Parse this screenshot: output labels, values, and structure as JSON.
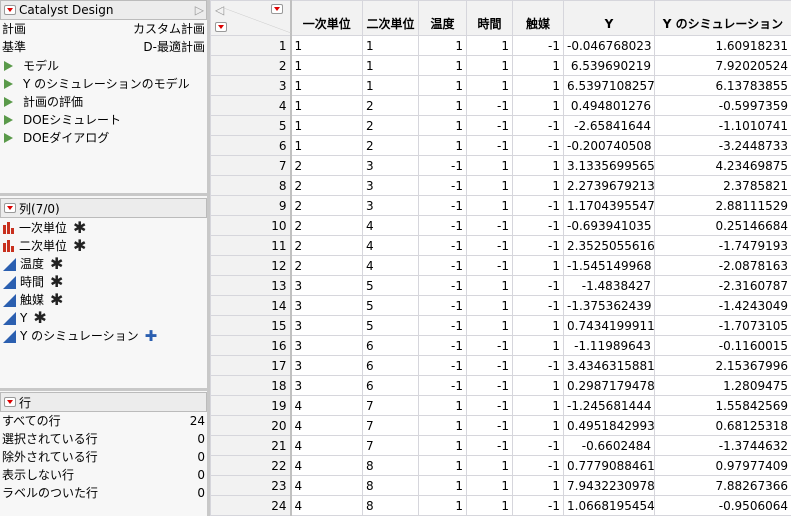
{
  "left": {
    "title": "Catalyst Design",
    "props": [
      {
        "k": "計画",
        "v": "カスタム計画"
      },
      {
        "k": "基準",
        "v": "D-最適計画"
      }
    ],
    "scripts": [
      "モデル",
      "Y のシミュレーションのモデル",
      "計画の評価",
      "DOEシミュレート",
      "DOEダイアログ"
    ],
    "columns_header": "列(7/0)",
    "columns": [
      {
        "name": "一次単位",
        "type": "nominal",
        "badge": "✱"
      },
      {
        "name": "二次単位",
        "type": "nominal",
        "badge": "✱"
      },
      {
        "name": "温度",
        "type": "continuous",
        "badge": "✱"
      },
      {
        "name": "時間",
        "type": "continuous",
        "badge": "✱"
      },
      {
        "name": "触媒",
        "type": "continuous",
        "badge": "✱"
      },
      {
        "name": "Y",
        "type": "continuous",
        "badge": "✱"
      },
      {
        "name": "Y のシミュレーション",
        "type": "continuous",
        "badge": "✚"
      }
    ],
    "rows_header": "行",
    "rows": [
      {
        "k": "すべての行",
        "v": "24"
      },
      {
        "k": "選択されている行",
        "v": "0"
      },
      {
        "k": "除外されている行",
        "v": "0"
      },
      {
        "k": "表示しない行",
        "v": "0"
      },
      {
        "k": "ラベルのついた行",
        "v": "0"
      }
    ]
  },
  "table": {
    "headers": [
      "一次単位",
      "二次単位",
      "温度",
      "時間",
      "触媒",
      "Y",
      "Y のシミュレーション"
    ],
    "rows": [
      [
        "1",
        "1",
        "1",
        "1",
        "1",
        "-1",
        "-0.046768023",
        "1.60918231"
      ],
      [
        "2",
        "1",
        "1",
        "1",
        "1",
        "1",
        "6.539690219",
        "7.92020524"
      ],
      [
        "3",
        "1",
        "1",
        "1",
        "1",
        "1",
        "6.5397108257",
        "6.13783855"
      ],
      [
        "4",
        "1",
        "2",
        "1",
        "-1",
        "1",
        "0.494801276",
        "-0.5997359"
      ],
      [
        "5",
        "1",
        "2",
        "1",
        "-1",
        "-1",
        "-2.65841644",
        "-1.1010741"
      ],
      [
        "6",
        "1",
        "2",
        "1",
        "-1",
        "-1",
        "-0.200740508",
        "-3.2448733"
      ],
      [
        "7",
        "2",
        "3",
        "-1",
        "1",
        "1",
        "3.1335699565",
        "4.23469875"
      ],
      [
        "8",
        "2",
        "3",
        "-1",
        "1",
        "1",
        "2.2739679213",
        "2.3785821"
      ],
      [
        "9",
        "2",
        "3",
        "-1",
        "1",
        "-1",
        "1.1704395547",
        "2.88111529"
      ],
      [
        "10",
        "2",
        "4",
        "-1",
        "-1",
        "-1",
        "-0.693941035",
        "0.25146684"
      ],
      [
        "11",
        "2",
        "4",
        "-1",
        "-1",
        "-1",
        "2.3525055616",
        "-1.7479193"
      ],
      [
        "12",
        "2",
        "4",
        "-1",
        "-1",
        "1",
        "-1.545149968",
        "-2.0878163"
      ],
      [
        "13",
        "3",
        "5",
        "-1",
        "1",
        "-1",
        "-1.4838427",
        "-2.3160787"
      ],
      [
        "14",
        "3",
        "5",
        "-1",
        "1",
        "-1",
        "-1.375362439",
        "-1.4243049"
      ],
      [
        "15",
        "3",
        "5",
        "-1",
        "1",
        "1",
        "0.7434199911",
        "-1.7073105"
      ],
      [
        "16",
        "3",
        "6",
        "-1",
        "-1",
        "1",
        "-1.11989643",
        "-0.1160015"
      ],
      [
        "17",
        "3",
        "6",
        "-1",
        "-1",
        "-1",
        "3.4346315881",
        "2.15367996"
      ],
      [
        "18",
        "3",
        "6",
        "-1",
        "-1",
        "1",
        "0.2987179478",
        "1.2809475"
      ],
      [
        "19",
        "4",
        "7",
        "1",
        "-1",
        "1",
        "-1.245681444",
        "1.55842569"
      ],
      [
        "20",
        "4",
        "7",
        "1",
        "-1",
        "1",
        "0.4951842993",
        "0.68125318"
      ],
      [
        "21",
        "4",
        "7",
        "1",
        "-1",
        "-1",
        "-0.6602484",
        "-1.3744632"
      ],
      [
        "22",
        "4",
        "8",
        "1",
        "1",
        "-1",
        "0.7779088461",
        "0.97977409"
      ],
      [
        "23",
        "4",
        "8",
        "1",
        "1",
        "1",
        "7.9432230978",
        "7.88267366"
      ],
      [
        "24",
        "4",
        "8",
        "1",
        "1",
        "-1",
        "1.0668195454",
        "-0.9506064"
      ]
    ]
  }
}
